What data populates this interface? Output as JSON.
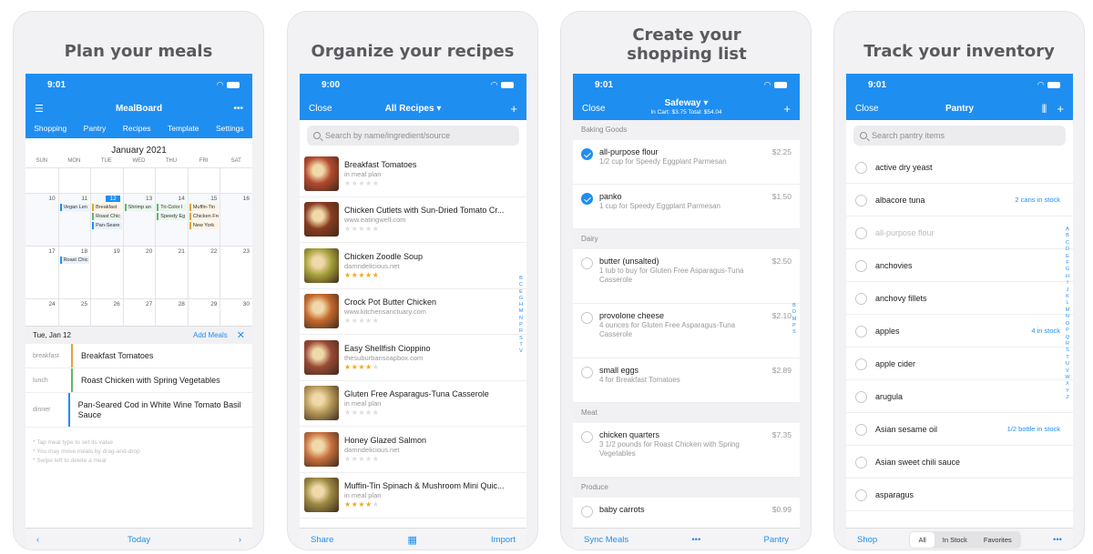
{
  "panels": {
    "planner": {
      "title": "Plan your meals",
      "time": "9:01",
      "app_title": "MealBoard",
      "tabs": [
        "Shopping",
        "Pantry",
        "Recipes",
        "Template",
        "Settings"
      ],
      "month": "January 2021",
      "weekdays": [
        "SUN",
        "MON",
        "TUE",
        "WED",
        "THU",
        "FRI",
        "SAT"
      ],
      "weeks": [
        [
          "",
          "",
          "",
          "",
          "",
          "",
          ""
        ],
        [
          "10",
          "11",
          "12",
          "13",
          "14",
          "15",
          "16"
        ],
        [
          "17",
          "18",
          "19",
          "20",
          "21",
          "22",
          "23"
        ],
        [
          "24",
          "25",
          "26",
          "27",
          "28",
          "29",
          "30"
        ]
      ],
      "chips": {
        "mon11": [
          "Vegan Len"
        ],
        "tue12": [
          "Breakfast",
          "Roast Chic",
          "Pan-Seare"
        ],
        "wed13": [
          "Shrimp an"
        ],
        "thu14": [
          "Tri-Color I",
          "Speedy Eg"
        ],
        "fri15": [
          "Muffin-Tin",
          "Chicken Fre",
          "New York"
        ],
        "mon18": [
          "Roast Chic"
        ]
      },
      "day_label": "Tue, Jan 12",
      "add_meals": "Add Meals",
      "meals": [
        {
          "type": "breakfast",
          "name": "Breakfast Tomatoes",
          "color": "#e6a23c"
        },
        {
          "type": "lunch",
          "name": "Roast Chicken with Spring Vegetables",
          "color": "#5fb86c"
        },
        {
          "type": "dinner",
          "name": "Pan-Seared Cod in White Wine Tomato Basil Sauce",
          "color": "#1f8ef1"
        }
      ],
      "tips": [
        "* Tap meal type to set its value",
        "* You may move meals by drag-and-drop",
        "* Swipe left to delete a meal"
      ],
      "bottom_today": "Today"
    },
    "recipes": {
      "title": "Organize your recipes",
      "time": "9:00",
      "close": "Close",
      "nav_title": "All Recipes ▾",
      "search_placeholder": "Search by name/ingredient/source",
      "items": [
        {
          "name": "Breakfast Tomatoes",
          "source": "in meal plan",
          "stars": 0,
          "color": "#b5492f"
        },
        {
          "name": "Chicken Cutlets with Sun-Dried Tomato Cr...",
          "source": "www.eatingwell.com",
          "stars": 0,
          "color": "#8a3c20"
        },
        {
          "name": "Chicken Zoodle Soup",
          "source": "damndelicious.net",
          "stars": 5,
          "color": "#a7a13c"
        },
        {
          "name": "Crock Pot Butter Chicken",
          "source": "www.kitchensanctuary.com",
          "stars": 0,
          "color": "#c4692c"
        },
        {
          "name": "Easy Shellfish Cioppino",
          "source": "thesuburbansoapbox.com",
          "stars": 4,
          "color": "#9a4a35"
        },
        {
          "name": "Gluten Free Asparagus-Tuna Casserole",
          "source": "in meal plan",
          "stars": 0,
          "color": "#b89a5a"
        },
        {
          "name": "Honey Glazed Salmon",
          "source": "damndelicious.net",
          "stars": 0,
          "color": "#c8713f"
        },
        {
          "name": "Muffin-Tin Spinach & Mushroom Mini Quic...",
          "source": "in meal plan",
          "stars": 4,
          "color": "#9c8a42"
        }
      ],
      "index": [
        "B",
        "C",
        "E",
        "G",
        "H",
        "M",
        "N",
        "P",
        "R",
        "S",
        "T",
        "V"
      ],
      "bottom_left": "Share",
      "bottom_right": "Import"
    },
    "shopping": {
      "title": "Create your shopping list",
      "time": "9:01",
      "close": "Close",
      "nav_title": "Safeway ▾",
      "nav_sub": "In Cart: $3.75   Total: $54.04",
      "sections": [
        {
          "name": "Baking Goods",
          "items": [
            {
              "name": "all-purpose flour",
              "desc": "1/2 cup for Speedy Eggplant Parmesan",
              "price": "$2.25",
              "checked": true
            },
            {
              "name": "panko",
              "desc": "1 cup for Speedy Eggplant Parmesan",
              "price": "$1.50",
              "checked": true
            }
          ]
        },
        {
          "name": "Dairy",
          "items": [
            {
              "name": "butter (unsalted)",
              "desc": "1 tub to buy for Gluten Free Asparagus-Tuna Casserole",
              "price": "$2.50",
              "checked": false
            },
            {
              "name": "provolone cheese",
              "desc": "4 ounces for Gluten Free Asparagus-Tuna Casserole",
              "price": "$2.10",
              "checked": false
            },
            {
              "name": "small eggs",
              "desc": "4 for Breakfast Tomatoes",
              "price": "$2.89",
              "checked": false
            }
          ]
        },
        {
          "name": "Meat",
          "items": [
            {
              "name": "chicken quarters",
              "desc": "3 1/2 pounds for Roast Chicken with Spring Vegetables",
              "price": "$7.35",
              "checked": false
            }
          ]
        },
        {
          "name": "Produce",
          "items": [
            {
              "name": "baby carrots",
              "desc": "",
              "price": "$0.99",
              "checked": false
            }
          ]
        }
      ],
      "index": [
        "B",
        "D",
        "M",
        "P",
        "S"
      ],
      "bottom_left": "Sync Meals",
      "bottom_right": "Pantry"
    },
    "pantry": {
      "title": "Track your inventory",
      "time": "9:01",
      "close": "Close",
      "nav_title": "Pantry",
      "search_placeholder": "Search pantry items",
      "items": [
        {
          "name": "active dry yeast",
          "stock": "",
          "dim": false
        },
        {
          "name": "albacore tuna",
          "stock": "2 cans in stock",
          "dim": false
        },
        {
          "name": "all-purpose flour",
          "stock": "",
          "dim": true
        },
        {
          "name": "anchovies",
          "stock": "",
          "dim": false
        },
        {
          "name": "anchovy fillets",
          "stock": "",
          "dim": false
        },
        {
          "name": "apples",
          "stock": "4 in stock",
          "dim": false
        },
        {
          "name": "apple cider",
          "stock": "",
          "dim": false
        },
        {
          "name": "arugula",
          "stock": "",
          "dim": false
        },
        {
          "name": "Asian sesame oil",
          "stock": "1/2 bottle in stock",
          "dim": false
        },
        {
          "name": "Asian sweet chili sauce",
          "stock": "",
          "dim": false
        },
        {
          "name": "asparagus",
          "stock": "",
          "dim": false
        }
      ],
      "index": [
        "A",
        "B",
        "C",
        "D",
        "E",
        "F",
        "G",
        "H",
        "I",
        "J",
        "K",
        "L",
        "M",
        "N",
        "O",
        "P",
        "Q",
        "R",
        "S",
        "T",
        "U",
        "V",
        "W",
        "X",
        "Y",
        "Z"
      ],
      "bottom_left": "Shop",
      "segments": [
        "All",
        "In Stock",
        "Favorites"
      ]
    }
  }
}
